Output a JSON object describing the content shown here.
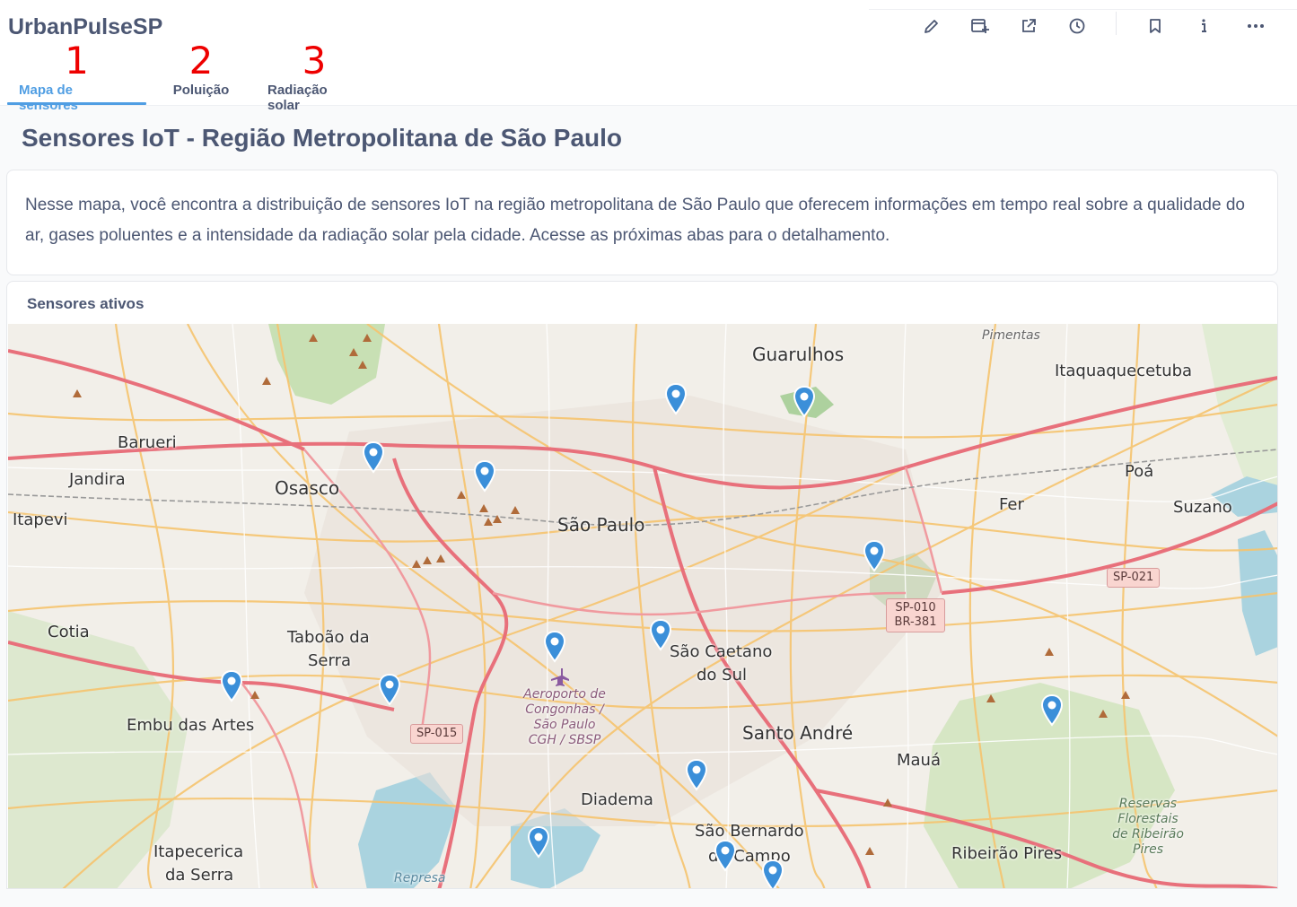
{
  "app": {
    "title": "UrbanPulseSP"
  },
  "tabs": [
    {
      "number": "1",
      "label": "Mapa de sensores",
      "active": true
    },
    {
      "number": "2",
      "label": "Poluição",
      "active": false
    },
    {
      "number": "3",
      "label": "Radiação solar",
      "active": false
    }
  ],
  "actions": [
    "pencil-icon",
    "add-to-dashboard-icon",
    "share-icon",
    "history-icon",
    "bookmark-icon",
    "info-icon",
    "more-icon"
  ],
  "page": {
    "title": "Sensores IoT - Região Metropolitana de São Paulo"
  },
  "description": "Nesse mapa, você encontra a distribuição de sensores IoT na região metropolitana de São Paulo que oferecem informações em tempo real sobre a qualidade do ar, gases poluentes e a intensidade da radiação solar pela cidade. Acesse as próximas abas para o detalhamento.",
  "map": {
    "title": "Sensores ativos",
    "places": {
      "guarulhos": "Guarulhos",
      "itaquaquecetuba": "Itaquaquecetuba",
      "barueri": "Barueri",
      "jandira": "Jandira",
      "osasco": "Osasco",
      "itapevi": "Itapevi",
      "sao_paulo": "São Paulo",
      "poa": "Poá",
      "suzano": "Suzano",
      "fer": "Fer",
      "cotia": "Cotia",
      "taboao1": "Taboão da",
      "taboao2": "Serra",
      "sao_caetano1": "São Caetano",
      "sao_caetano2": "do Sul",
      "embu": "Embu das Artes",
      "santo_andre": "Santo André",
      "maua": "Mauá",
      "diadema": "Diadema",
      "sao_bernardo1": "São Bernardo",
      "sao_bernardo2": "do Campo",
      "itapecerica1": "Itapecerica",
      "itapecerica2": "da Serra",
      "ribeirao_pires": "Ribeirão Pires",
      "aeroporto": "Aeroporto de Congonhas / São Paulo CGH / SBSP",
      "reservas": "Reservas Florestais de Ribeirão Pires",
      "pimentas": "Pimentas",
      "represa": "Represa"
    },
    "shields": [
      "SP-010 BR-381",
      "SP-021",
      "SP-015"
    ],
    "sensor_count": 16,
    "marker_color": "#3b8fd9"
  }
}
